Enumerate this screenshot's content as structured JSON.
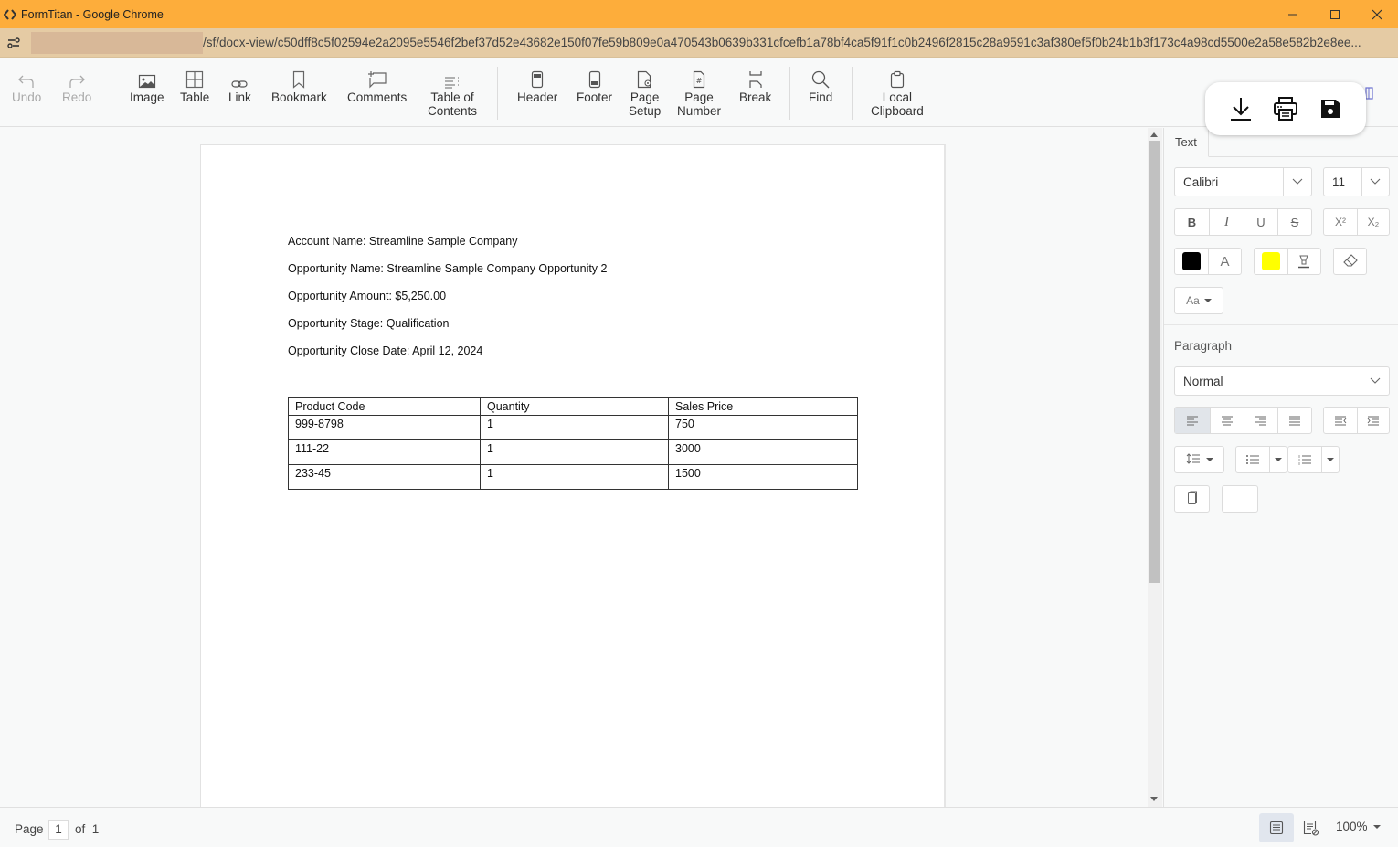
{
  "window": {
    "title": "FormTitan - Google Chrome",
    "url": "/sf/docx-view/c50dff8c5f02594e2a2095e5546f2bef37d52e43682e150f07fe59b809e0a470543b0639b331cfcefb1a78bf4ca5f91f1c0b2496f2815c28a9591c3af380ef5f0b24b1b3f173c4a98cd5500e2a58e582b2e8ee..."
  },
  "toolbar": {
    "undo": "Undo",
    "redo": "Redo",
    "image": "Image",
    "table": "Table",
    "link": "Link",
    "bookmark": "Bookmark",
    "comments": "Comments",
    "toc_1": "Table of",
    "toc_2": "Contents",
    "header": "Header",
    "footer": "Footer",
    "page_setup_1": "Page",
    "page_setup_2": "Setup",
    "page_number_1": "Page",
    "page_number_2": "Number",
    "break": "Break",
    "find": "Find",
    "clipboard_1": "Local",
    "clipboard_2": "Clipboard"
  },
  "float_actions": [
    "download-icon",
    "print-icon",
    "save-icon"
  ],
  "document": {
    "lines": [
      "Account Name: Streamline Sample Company",
      "Opportunity Name: Streamline Sample Company Opportunity 2",
      "Opportunity Amount: $5,250.00",
      "Opportunity Stage: Qualification",
      "Opportunity Close Date: April 12, 2024"
    ],
    "table": {
      "headers": [
        "Product Code",
        "Quantity",
        "Sales Price"
      ],
      "rows": [
        [
          "999-8798",
          "1",
          "750"
        ],
        [
          "111-22",
          "1",
          "3000"
        ],
        [
          "233-45",
          "1",
          "1500"
        ]
      ]
    }
  },
  "properties": {
    "tab_text": "Text",
    "font_family": "Calibri",
    "font_size": "11",
    "bold": "B",
    "italic": "I",
    "underline": "U",
    "strikethrough": "S",
    "superscript": "X²",
    "subscript": "X₂",
    "font_color": "#000000",
    "font_color_glyph": "A",
    "highlight_color": "#ffff00",
    "change_case": "Aa",
    "paragraph_title": "Paragraph",
    "paragraph_style": "Normal"
  },
  "status": {
    "page_label": "Page",
    "page_current": "1",
    "page_of": "of",
    "page_total": "1",
    "zoom": "100%"
  }
}
